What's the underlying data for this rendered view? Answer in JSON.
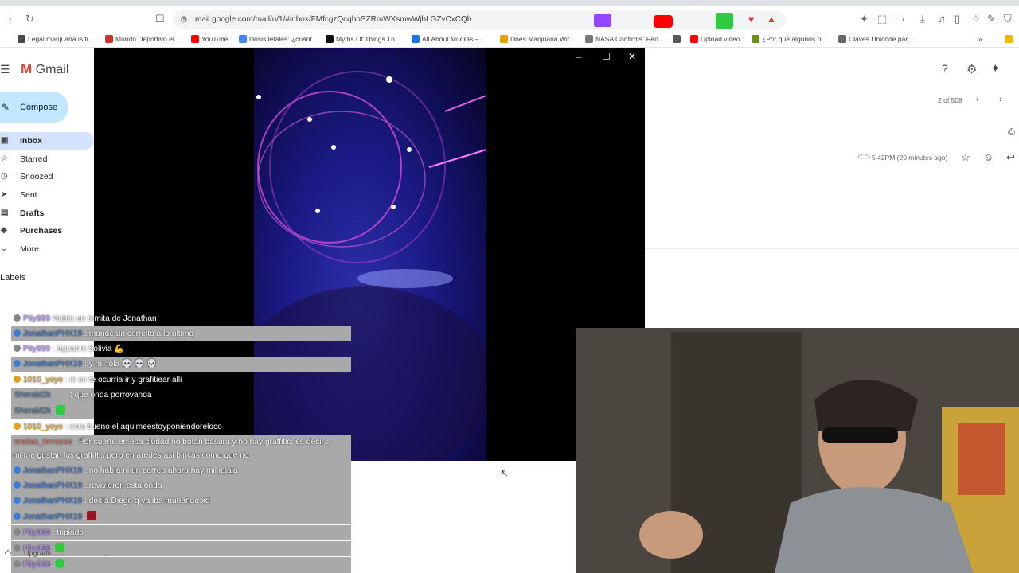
{
  "browser": {
    "url": "mail.google.com/mail/u/1/#inbox/FMfcgzQcqbbSZRmWXsmwWjbLGZvCxCQb",
    "bookmarks": [
      {
        "label": "Legal marijuana is fi...",
        "color": "#4a4a4a"
      },
      {
        "label": "Mundo Deportivo el...",
        "color": "#c0392b"
      },
      {
        "label": "YouTube",
        "color": "#ff0000"
      },
      {
        "label": "Dosis letales: ¿cuánt...",
        "color": "#4285f4"
      },
      {
        "label": "Myths Of Things Th...",
        "color": "#111111"
      },
      {
        "label": "All About Mudras –...",
        "color": "#1a73e8"
      },
      {
        "label": "Does Marijuana Wit...",
        "color": "#e8a000"
      },
      {
        "label": "NASA Confirms: Peo...",
        "color": "#777777"
      },
      {
        "label": "",
        "color": "#555555"
      },
      {
        "label": "Upload video",
        "color": "#ff0000"
      },
      {
        "label": "¿Por qué algunos p...",
        "color": "#6b8e23"
      },
      {
        "label": "Claves Unicode par...",
        "color": "#666666"
      }
    ]
  },
  "gmail": {
    "brand": "Gmail",
    "compose": "Compose",
    "nav": [
      {
        "label": "Inbox",
        "icon": "inbox-icon",
        "active": true
      },
      {
        "label": "Starred",
        "icon": "star-icon"
      },
      {
        "label": "Snoozed",
        "icon": "clock-icon"
      },
      {
        "label": "Sent",
        "icon": "send-icon"
      },
      {
        "label": "Drafts",
        "icon": "draft-icon"
      },
      {
        "label": "Purchases",
        "icon": "tag-icon"
      },
      {
        "label": "More",
        "icon": "chevron-down-icon"
      }
    ],
    "labels_heading": "Labels",
    "pagination": "2 of 508",
    "email_time": "5:42PM (20 minutes ago)",
    "upgrade": "Upgrade"
  },
  "chat": [
    {
      "user": "Pity999",
      "color": "#b58cff",
      "text": "Había un temita de Jonathan",
      "bg": false
    },
    {
      "user": "JonathanPHX19",
      "color": "#3c7bd6",
      "text": ": mandé un correito a lo ultimo",
      "bg": true
    },
    {
      "user": "Pity999",
      "color": "#b58cff",
      "text": ": Aguante bolivia 💪",
      "bg": false
    },
    {
      "user": "JonathanPHX19",
      "color": "#3c7bd6",
      "text": ": y mi rola 💀 💀 💀",
      "bg": true
    },
    {
      "user": "1010_yoyo",
      "color": "#e0a020",
      "text": ": ni se te ocurria ir y grafitiear alli",
      "bg": false
    },
    {
      "user": "Sherald2k",
      "color": "#5577aa",
      "text": ": que onda porrovanda",
      "bg": true
    },
    {
      "user": "Sherald2k",
      "color": "#5577aa",
      "text": ":",
      "bg": true
    },
    {
      "user": "1010_yoyo",
      "color": "#e0a020",
      "text": ": esta bueno el aquimeestoyponiendoreloco",
      "bg": false
    },
    {
      "user": "matias_terrazas",
      "color": "#e07070",
      "text": ": Por suerte en esa ciudad no botan basura y no hay graffitis, es decir a",
      "bg": true
    },
    {
      "user": "",
      "color": "#ffffff",
      "text": "mi me gustan los graffittis pero en aredes asi bincas como que no.",
      "bg": true
    },
    {
      "user": "JonathanPHX19",
      "color": "#3c7bd6",
      "text": ": no había ni un correo ahora hay mil jajaja",
      "bg": true
    },
    {
      "user": "JonathanPHX19",
      "color": "#3c7bd6",
      "text": ": revivieron esta onda",
      "bg": true
    },
    {
      "user": "JonathanPHX19",
      "color": "#3c7bd6",
      "text": ": decía Diego q ya iba muriendo xd",
      "bg": true
    },
    {
      "user": "JonathanPHX19",
      "color": "#3c7bd6",
      "text": ":",
      "bg": true
    },
    {
      "user": "Pity999",
      "color": "#b58cff",
      "text": ": tripiado",
      "bg": true
    },
    {
      "user": "Pity999",
      "color": "#b58cff",
      "text": ":",
      "bg": true
    },
    {
      "user": "Pity999",
      "color": "#b58cff",
      "text": ":",
      "bg": true
    }
  ]
}
